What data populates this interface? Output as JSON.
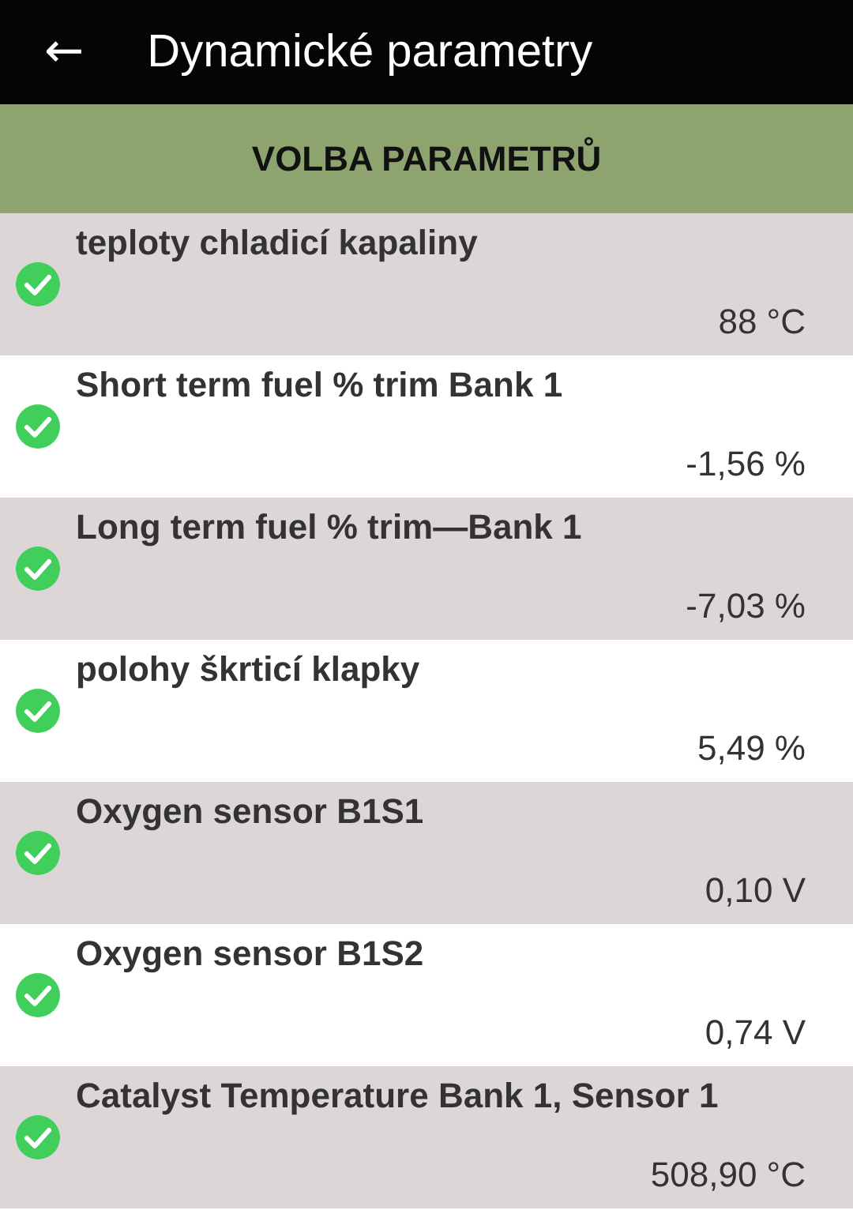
{
  "app_bar": {
    "back_icon": "←",
    "title": "Dynamické parametry"
  },
  "section_header": "VOLBA PARAMETRŮ",
  "parameters": [
    {
      "name": "teploty chladicí kapaliny",
      "value": "88 °C",
      "checked": true
    },
    {
      "name": "Short term fuel % trim Bank 1",
      "value": "-1,56 %",
      "checked": true
    },
    {
      "name": "Long term fuel % trim—Bank 1",
      "value": "-7,03 %",
      "checked": true
    },
    {
      "name": "polohy škrticí klapky",
      "value": "5,49 %",
      "checked": true
    },
    {
      "name": "Oxygen sensor B1S1",
      "value": "0,10 V",
      "checked": true
    },
    {
      "name": "Oxygen sensor B1S2",
      "value": "0,74 V",
      "checked": true
    },
    {
      "name": "Catalyst Temperature Bank 1, Sensor 1",
      "value": "508,90 °C",
      "checked": true
    }
  ]
}
